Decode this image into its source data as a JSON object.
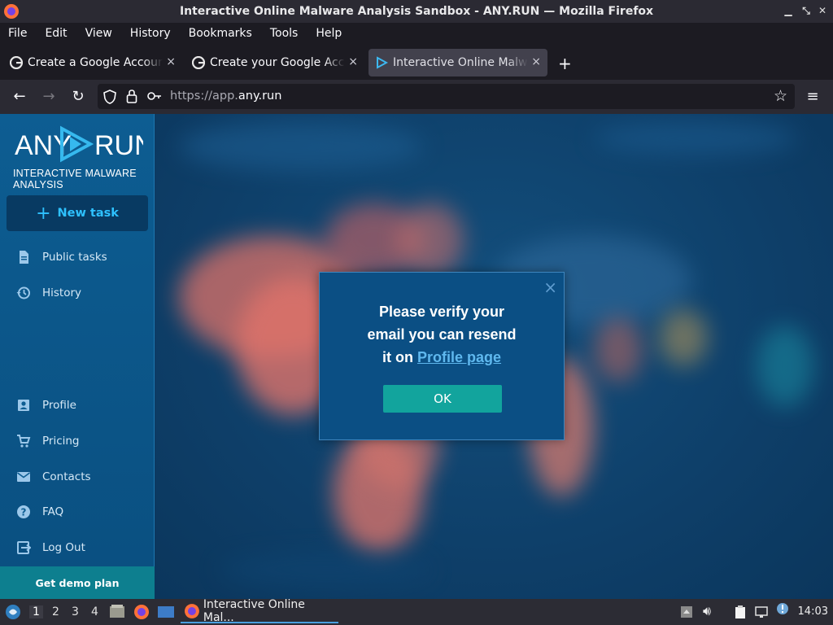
{
  "window": {
    "title": "Interactive Online Malware Analysis Sandbox - ANY.RUN — Mozilla Firefox"
  },
  "menu": [
    "File",
    "Edit",
    "View",
    "History",
    "Bookmarks",
    "Tools",
    "Help"
  ],
  "tabs": [
    {
      "label": "Create a Google Account",
      "close": "×"
    },
    {
      "label": "Create your Google Account",
      "close": "×"
    },
    {
      "label": "Interactive Online Malware Analysis Sandbox",
      "close": "×"
    }
  ],
  "new_tab": "+",
  "url": {
    "scheme": "https://app.",
    "domain": "any.run"
  },
  "sidebar": {
    "logo_left": "ANY",
    "logo_right": "RUN",
    "subtitle": "INTERACTIVE MALWARE ANALYSIS",
    "new_task": "New task",
    "items_top": [
      "Public tasks",
      "History"
    ],
    "items_bottom": [
      "Profile",
      "Pricing",
      "Contacts",
      "FAQ",
      "Log Out"
    ],
    "demo": "Get demo plan"
  },
  "dialog": {
    "line1": "Please verify your",
    "line2": "email you can resend",
    "line3_prefix": "it on ",
    "link": "Profile page",
    "ok": "OK",
    "close": "×"
  },
  "taskbar": {
    "workspaces": [
      "1",
      "2",
      "3",
      "4"
    ],
    "app": "Interactive Online Mal...",
    "clock": "14:03"
  },
  "colors": {
    "accent": "#2ec1ff",
    "ok_button": "#12a49d",
    "sidebar": "#0d5d92",
    "demo": "#0d7f8f"
  }
}
